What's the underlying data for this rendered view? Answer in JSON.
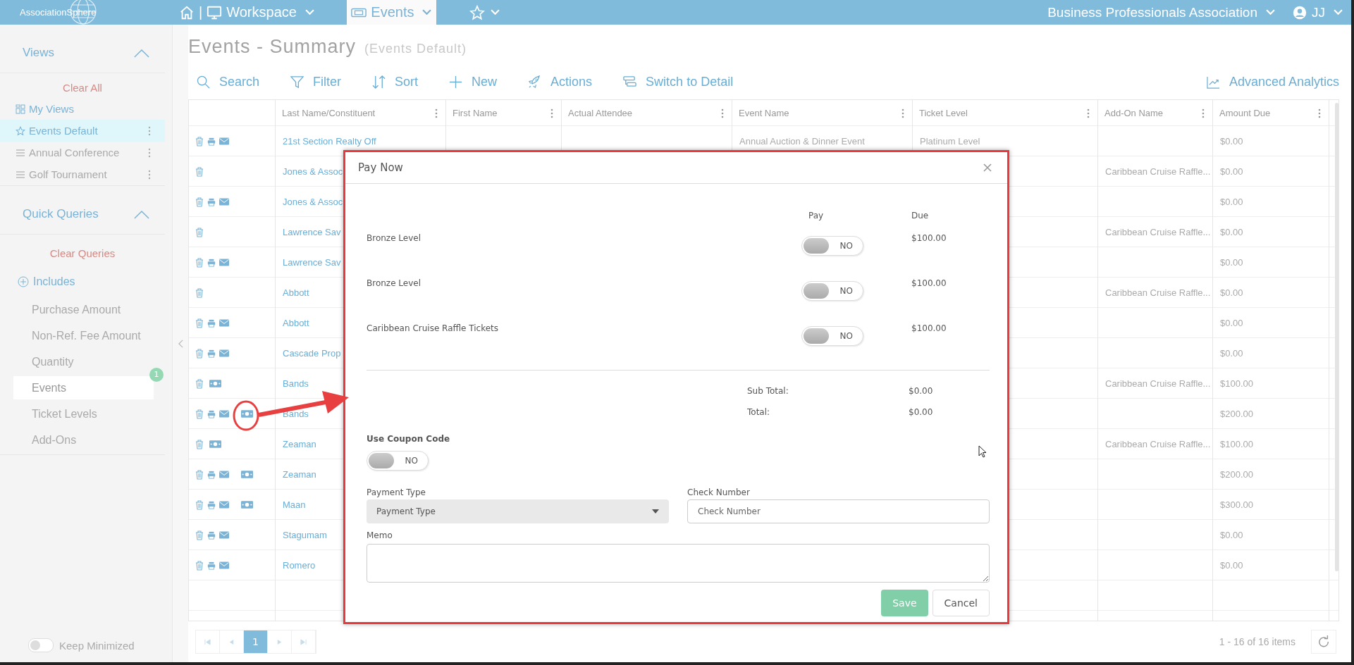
{
  "nav": {
    "logo": "AssociationSphere",
    "separator": "|",
    "workspace": "Workspace",
    "tabs": [
      {
        "label": "Events",
        "selected": true
      }
    ],
    "organization": "Business Professionals Association",
    "user": "JJ"
  },
  "sidebar": {
    "views": {
      "title": "Views",
      "expanded": true,
      "clear": "Clear All",
      "items": [
        {
          "label": "My Views",
          "kind": "group",
          "selected": false
        },
        {
          "label": "Events Default",
          "kind": "default",
          "selected": true
        },
        {
          "label": "Annual Conference",
          "kind": "view",
          "selected": false
        },
        {
          "label": "Golf Tournament",
          "kind": "view",
          "selected": false
        }
      ]
    },
    "quick_queries": {
      "title": "Quick Queries",
      "expanded": true,
      "clear": "Clear Queries",
      "includes": "Includes",
      "items": [
        {
          "label": "Purchase Amount",
          "selected": false
        },
        {
          "label": "Non-Ref. Fee Amount",
          "selected": false
        },
        {
          "label": "Quantity",
          "selected": false
        },
        {
          "label": "Events",
          "selected": true,
          "badge": "1"
        },
        {
          "label": "Ticket Levels",
          "selected": false
        },
        {
          "label": "Add-Ons",
          "selected": false
        }
      ]
    },
    "keep_minimized": {
      "label": "Keep Minimized",
      "on": false
    }
  },
  "page": {
    "title": "Events - Summary",
    "subtitle": "(Events Default)"
  },
  "toolbar": [
    {
      "label": "Search"
    },
    {
      "label": "Filter"
    },
    {
      "label": "Sort"
    },
    {
      "label": "New"
    },
    {
      "label": "Actions"
    },
    {
      "label": "Switch to Detail"
    }
  ],
  "analytics": "Advanced Analytics",
  "table": {
    "columns": [
      "Last Name/Constituent",
      "First Name",
      "Actual Attendee",
      "Event Name",
      "Ticket Level",
      "Add-On Name",
      "Amount Due"
    ],
    "rows": [
      {
        "name": "21st Section Realty Off",
        "event": "Annual Auction & Dinner Event",
        "ticket": "Platinum Level",
        "amount": "$0.00",
        "print": true,
        "mail": true,
        "pay": false
      },
      {
        "name": "Jones & Assoc",
        "addon": "Caribbean Cruise Raffle...",
        "amount": "$0.00",
        "print": false,
        "mail": false,
        "pay": false
      },
      {
        "name": "Jones & Assoc",
        "amount": "$0.00",
        "print": true,
        "mail": true,
        "pay": false
      },
      {
        "name": "Lawrence Sav",
        "addon": "Caribbean Cruise Raffle...",
        "amount": "$0.00",
        "print": false,
        "mail": false,
        "pay": false
      },
      {
        "name": "Lawrence Sav",
        "amount": "$0.00",
        "print": true,
        "mail": true,
        "pay": false
      },
      {
        "name": "Abbott",
        "addon": "Caribbean Cruise Raffle...",
        "amount": "$0.00",
        "print": false,
        "mail": false,
        "pay": false
      },
      {
        "name": "Abbott",
        "amount": "$0.00",
        "print": true,
        "mail": true,
        "pay": false
      },
      {
        "name": "Cascade Prop",
        "amount": "$0.00",
        "print": true,
        "mail": true,
        "pay": false
      },
      {
        "name": "Bands",
        "addon": "Caribbean Cruise Raffle...",
        "amount": "$100.00",
        "print": false,
        "mail": false,
        "pay": true
      },
      {
        "name": "Bands",
        "amount": "$200.00",
        "print": true,
        "mail": true,
        "pay": true
      },
      {
        "name": "Zeaman",
        "addon": "Caribbean Cruise Raffle...",
        "amount": "$100.00",
        "print": false,
        "mail": false,
        "pay": true
      },
      {
        "name": "Zeaman",
        "amount": "$200.00",
        "print": true,
        "mail": true,
        "pay": true
      },
      {
        "name": "Maan",
        "amount": "$300.00",
        "print": true,
        "mail": true,
        "pay": true
      },
      {
        "name": "Stagumam",
        "amount": "$0.00",
        "print": true,
        "mail": true,
        "pay": false
      },
      {
        "name": "Romero",
        "amount": "$0.00",
        "print": true,
        "mail": true,
        "pay": false
      }
    ]
  },
  "pager": {
    "pages": [
      {
        "label": "1",
        "selected": true
      }
    ],
    "summary": "1 - 16 of 16 items"
  },
  "modal": {
    "title": "Pay Now",
    "pay_header": "Pay",
    "due_header": "Due",
    "items": [
      {
        "label": "Bronze Level",
        "on": false,
        "toggle": "NO",
        "due": "$100.00"
      },
      {
        "label": "Bronze Level",
        "on": false,
        "toggle": "NO",
        "due": "$100.00"
      },
      {
        "label": "Caribbean Cruise Raffle Tickets",
        "on": false,
        "toggle": "NO",
        "due": "$100.00"
      }
    ],
    "subtotal_label": "Sub Total:",
    "subtotal": "$0.00",
    "total_label": "Total:",
    "total": "$0.00",
    "coupon": {
      "label": "Use Coupon Code",
      "on": false,
      "toggle": "NO"
    },
    "payment_type": {
      "label": "Payment Type",
      "placeholder": "Payment Type"
    },
    "check_number": {
      "label": "Check Number",
      "placeholder": "Check Number"
    },
    "memo": {
      "label": "Memo"
    },
    "buttons": [
      {
        "label": "Save",
        "kind": "primary",
        "disabled": true
      },
      {
        "label": "Cancel",
        "kind": "secondary",
        "disabled": false
      }
    ]
  }
}
